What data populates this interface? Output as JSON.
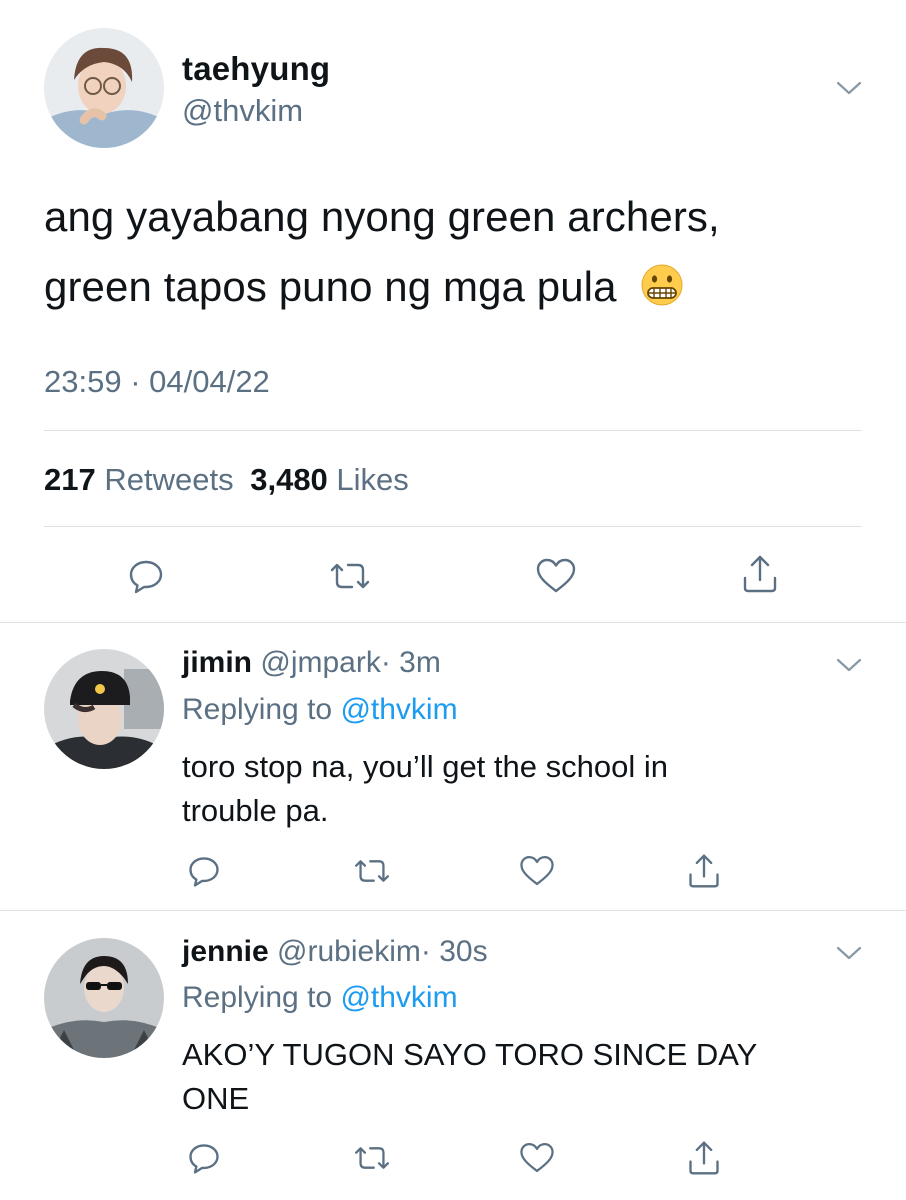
{
  "main_tweet": {
    "name": "taehyung",
    "handle": "@thvkim",
    "text_line1": "ang yayabang nyong green archers,",
    "text_line2": "green tapos puno ng mga pula",
    "emoji": "grimacing-face",
    "timestamp": "23:59 · 04/04/22",
    "retweets_count": "217",
    "retweets_label": "Retweets",
    "likes_count": "3,480",
    "likes_label": "Likes"
  },
  "replies": [
    {
      "name": "jimin",
      "handle": "@jmpark",
      "time": "· 3m",
      "replying_prefix": "Replying to",
      "replying_to": "@thvkim",
      "text_line1": "toro stop na, you’ll get the school in",
      "text_line2": "trouble pa."
    },
    {
      "name": "jennie",
      "handle": "@rubiekim",
      "time": "· 30s",
      "replying_prefix": "Replying to",
      "replying_to": "@thvkim",
      "text_line1": "AKO’Y TUGON SAYO TORO SINCE DAY",
      "text_line2": "ONE"
    }
  ],
  "colors": {
    "text": "#0f1419",
    "secondary": "#5b7083",
    "mention": "#1d9bf0",
    "divider": "#dfe3e6"
  }
}
